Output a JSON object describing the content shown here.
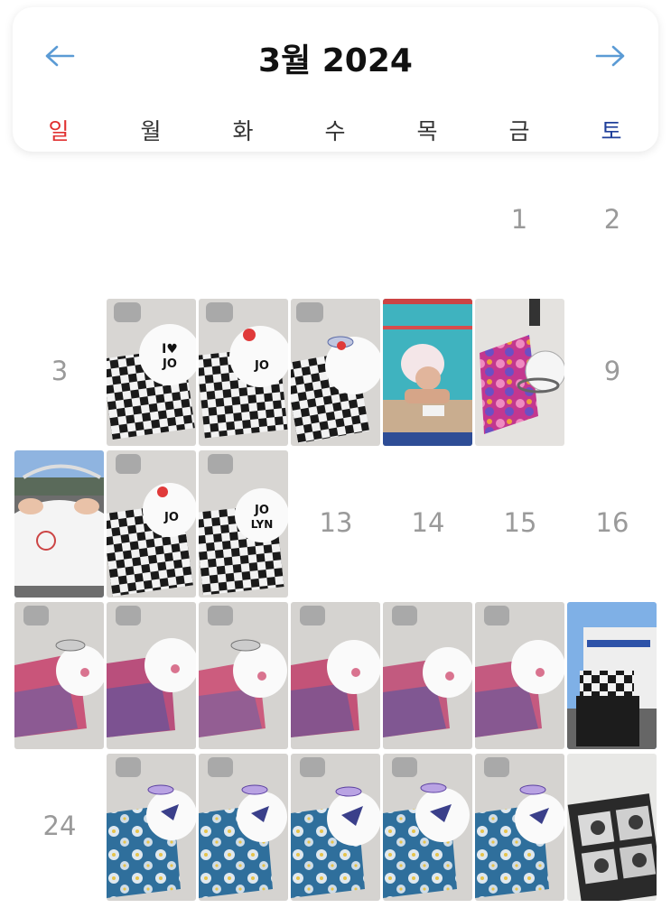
{
  "header": {
    "title": "3월 2024",
    "prev_label": "←",
    "next_label": "→"
  },
  "weekdays": [
    "일",
    "월",
    "화",
    "수",
    "목",
    "금",
    "토"
  ],
  "days": {
    "d1": "1",
    "d2": "2",
    "d3": "3",
    "d9": "9",
    "d13": "13",
    "d14": "14",
    "d15": "15",
    "d16": "16",
    "d24": "24"
  },
  "colors": {
    "sunday": "#e03030",
    "saturday": "#1f3f9a",
    "arrow": "#5b9bd5",
    "daynum": "#9a9a9a"
  },
  "photos": [
    {
      "day": 4,
      "theme": "checkered-swimsuit-jolyn-cap"
    },
    {
      "day": 5,
      "theme": "checkered-swimsuit-jolyn-cap"
    },
    {
      "day": 6,
      "theme": "checkered-swimsuit-jolyn-cap"
    },
    {
      "day": 7,
      "theme": "pool-swimmer-selfie"
    },
    {
      "day": 8,
      "theme": "floral-swimsuit-goggles"
    },
    {
      "day": 10,
      "theme": "stadium-white-cap"
    },
    {
      "day": 11,
      "theme": "checkered-swimsuit-jolyn-cap"
    },
    {
      "day": 12,
      "theme": "checkered-swimsuit-jolyn-cap"
    },
    {
      "day": 17,
      "theme": "pink-swimsuit-cherry-cap"
    },
    {
      "day": 18,
      "theme": "pink-swimsuit-cherry-cap"
    },
    {
      "day": 19,
      "theme": "pink-swimsuit-cherry-cap"
    },
    {
      "day": 20,
      "theme": "pink-swimsuit-cherry-cap"
    },
    {
      "day": 21,
      "theme": "pink-swimsuit-cherry-cap"
    },
    {
      "day": 22,
      "theme": "pink-swimsuit-cherry-cap"
    },
    {
      "day": 23,
      "theme": "building-checkered-bag"
    },
    {
      "day": 25,
      "theme": "blue-floral-swimsuit-bird-cap"
    },
    {
      "day": 26,
      "theme": "blue-floral-swimsuit-bird-cap"
    },
    {
      "day": 27,
      "theme": "blue-floral-swimsuit-bird-cap"
    },
    {
      "day": 28,
      "theme": "blue-floral-swimsuit-bird-cap"
    },
    {
      "day": 29,
      "theme": "blue-floral-swimsuit-bird-cap"
    },
    {
      "day": 30,
      "theme": "photo-booth-strip"
    }
  ]
}
